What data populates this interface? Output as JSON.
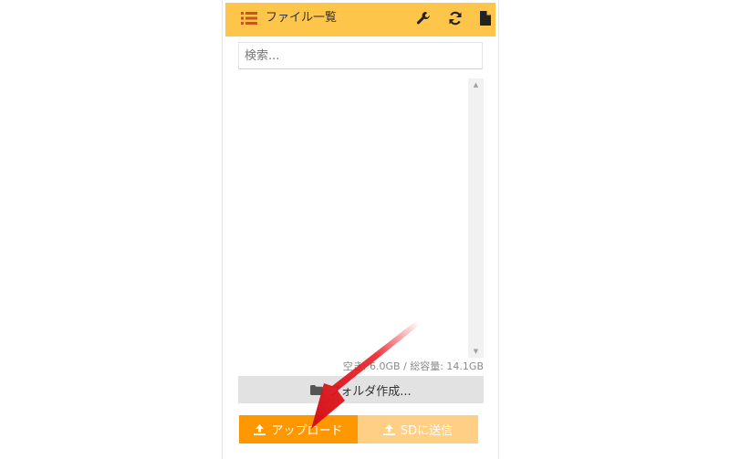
{
  "header": {
    "title": "ファイル一覧",
    "list_icon": "list-icon",
    "settings_icon": "wrench-icon",
    "refresh_icon": "refresh-icon",
    "file_icon": "file-icon",
    "background": "#fdc54a"
  },
  "search": {
    "placeholder": "検索..."
  },
  "storage": {
    "text": "空き: 6.0GB / 総容量: 14.1GB"
  },
  "actions": {
    "new_folder_label": "フォルダ作成...",
    "upload_label": "アップロード",
    "send_sd_label": "SDに送信",
    "upload_color": "#ff9800",
    "send_sd_color": "#ffcf86"
  },
  "annotation": {
    "arrow_icon": "red-arrow-icon",
    "arrow_color": "#e8141c"
  }
}
